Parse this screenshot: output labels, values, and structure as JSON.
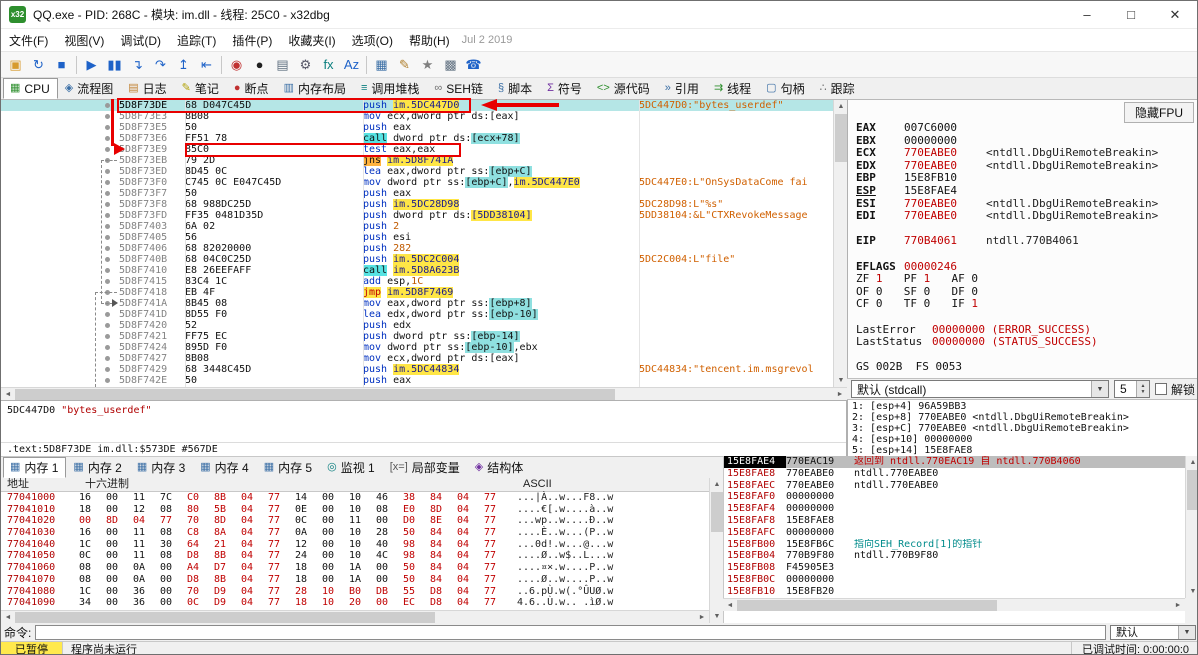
{
  "icons": {
    "minimize": "–",
    "maximize": "□",
    "close": "✕",
    "sb_up": "▲",
    "sb_down": "▼",
    "sb_left": "◄",
    "sb_right": "►",
    "combo_arrow": "▼",
    "spin_up": "▲",
    "spin_down": "▼",
    "app_badge": "x32"
  },
  "window": {
    "title": "QQ.exe - PID: 268C - 模块: im.dll - 线程: 25C0 - x32dbg"
  },
  "menu": {
    "items": [
      "文件(F)",
      "视图(V)",
      "调试(D)",
      "追踪(T)",
      "插件(P)",
      "收藏夹(I)",
      "选项(O)",
      "帮助(H)"
    ],
    "date": "Jul 2 2019"
  },
  "toolbar": {
    "items": [
      {
        "name": "open-file",
        "glyph": "▣",
        "color": "#d79b2e"
      },
      {
        "name": "restart",
        "glyph": "↻",
        "color": "#1e62c8"
      },
      {
        "name": "stop-debug",
        "glyph": "■",
        "color": "#1e62c8"
      },
      {
        "sep": true
      },
      {
        "name": "run",
        "glyph": "▶",
        "color": "#1e62c8"
      },
      {
        "name": "pause",
        "glyph": "▮▮",
        "color": "#1e62c8"
      },
      {
        "name": "step-into",
        "glyph": "↴",
        "color": "#1e62c8"
      },
      {
        "name": "step-over",
        "glyph": "↷",
        "color": "#1e62c8"
      },
      {
        "name": "step-out",
        "glyph": "↥",
        "color": "#1e62c8"
      },
      {
        "name": "execute-till-return",
        "glyph": "⇤",
        "color": "#1e62c8"
      },
      {
        "sep": true
      },
      {
        "name": "trace-record",
        "glyph": "◉",
        "color": "#c03030"
      },
      {
        "name": "breakpoints",
        "glyph": "●",
        "color": "#202020"
      },
      {
        "name": "memory-page",
        "glyph": "▤",
        "color": "#607080"
      },
      {
        "name": "settings-gear",
        "glyph": "⚙",
        "color": "#555566"
      },
      {
        "name": "script-fx",
        "glyph": "fx",
        "color": "#0b7f7f"
      },
      {
        "name": "font-size",
        "glyph": "Az",
        "color": "#1e62c8"
      },
      {
        "sep": true
      },
      {
        "name": "patches",
        "glyph": "▦",
        "color": "#3a6ea5"
      },
      {
        "name": "comment",
        "glyph": "✎",
        "color": "#b08030"
      },
      {
        "name": "favourites",
        "glyph": "★",
        "color": "#808080"
      },
      {
        "name": "calculator",
        "glyph": "▩",
        "color": "#607080"
      },
      {
        "name": "attach",
        "glyph": "☎",
        "color": "#1e62c8"
      }
    ]
  },
  "tabs": [
    {
      "id": "cpu",
      "label": "CPU",
      "glyph": "▦",
      "color": "#2e8f2e",
      "active": true
    },
    {
      "id": "graph",
      "label": "流程图",
      "glyph": "◈",
      "color": "#3a6ea5"
    },
    {
      "id": "log",
      "label": "日志",
      "glyph": "▤",
      "color": "#c08030"
    },
    {
      "id": "notes",
      "label": "笔记",
      "glyph": "✎",
      "color": "#b0a000"
    },
    {
      "id": "breakpoints",
      "label": "断点",
      "glyph": "●",
      "color": "#c03030"
    },
    {
      "id": "memory-map",
      "label": "内存布局",
      "glyph": "▥",
      "color": "#3a6ea5"
    },
    {
      "id": "call-stack",
      "label": "调用堆栈",
      "glyph": "≡",
      "color": "#0b7f7f"
    },
    {
      "id": "seh",
      "label": "SEH链",
      "glyph": "∞",
      "color": "#707070"
    },
    {
      "id": "script",
      "label": "脚本",
      "glyph": "§",
      "color": "#3a6ea5"
    },
    {
      "id": "symbols",
      "label": "符号",
      "glyph": "Σ",
      "color": "#7030a0"
    },
    {
      "id": "source",
      "label": "源代码",
      "glyph": "<>",
      "color": "#2e8f2e"
    },
    {
      "id": "references",
      "label": "引用",
      "glyph": "»",
      "color": "#3a6ea5"
    },
    {
      "id": "threads",
      "label": "线程",
      "glyph": "⇉",
      "color": "#2e8f2e"
    },
    {
      "id": "handles",
      "label": "句柄",
      "glyph": "▢",
      "color": "#3a6ea5"
    },
    {
      "id": "trace",
      "label": "跟踪",
      "glyph": "∴",
      "color": "#707070"
    }
  ],
  "disasm": {
    "rows": [
      {
        "addr": "5D8F73DE",
        "bytes": "68 D047C45D",
        "instr": [
          [
            "push",
            "mn"
          ],
          [
            " ",
            "k"
          ],
          [
            "im.5DC447D0",
            "ay"
          ]
        ],
        "cmt": "5DC447D0:\"bytes_userdef\"",
        "sel": true
      },
      {
        "addr": "5D8F73E3",
        "bytes": "8B08",
        "instr": [
          [
            "mov",
            "mn"
          ],
          [
            " ecx,dword ptr ds:[eax]",
            "k"
          ]
        ]
      },
      {
        "addr": "5D8F73E5",
        "bytes": "50",
        "instr": [
          [
            "push",
            "mn"
          ],
          [
            " eax",
            "k"
          ]
        ]
      },
      {
        "addr": "5D8F73E6",
        "bytes": "FF51 78",
        "instr": [
          [
            "call",
            "callbg"
          ],
          [
            " dword ptr ds:",
            "k"
          ],
          [
            "[ecx+78]",
            "cy"
          ]
        ]
      },
      {
        "addr": "5D8F73E9",
        "bytes": "85C0",
        "instr": [
          [
            "test",
            "mn"
          ],
          [
            " eax,eax",
            "k"
          ]
        ]
      },
      {
        "addr": "5D8F73EB",
        "bytes": "79 2D",
        "instr": [
          [
            "jns",
            "jnsbg"
          ],
          [
            " ",
            "k"
          ],
          [
            "im.5D8F741A",
            "ay"
          ]
        ]
      },
      {
        "addr": "5D8F73ED",
        "bytes": "8D45 0C",
        "instr": [
          [
            "lea",
            "mn"
          ],
          [
            " eax,dword ptr ss:",
            "k"
          ],
          [
            "[ebp+C]",
            "cy"
          ]
        ]
      },
      {
        "addr": "5D8F73F0",
        "bytes": "C745 0C E047C45D",
        "instr": [
          [
            "mov",
            "mn"
          ],
          [
            " dword ptr ss:",
            "k"
          ],
          [
            "[ebp+C]",
            "cy"
          ],
          [
            ",",
            "k"
          ],
          [
            "im.5DC447E0",
            "ay"
          ]
        ],
        "cmt": "5DC447E0:L\"OnSysDataCome fai"
      },
      {
        "addr": "5D8F73F7",
        "bytes": "50",
        "instr": [
          [
            "push",
            "mn"
          ],
          [
            " eax",
            "k"
          ]
        ]
      },
      {
        "addr": "5D8F73F8",
        "bytes": "68 988DC25D",
        "instr": [
          [
            "push",
            "mn"
          ],
          [
            " ",
            "k"
          ],
          [
            "im.5DC28D98",
            "ay"
          ]
        ],
        "cmt": "5DC28D98:L\"%s\""
      },
      {
        "addr": "5D8F73FD",
        "bytes": "FF35 0481D35D",
        "instr": [
          [
            "push",
            "mn"
          ],
          [
            " dword ptr ds:",
            "k"
          ],
          [
            "[5DD38104]",
            "ay"
          ]
        ],
        "cmt": "5DD38104:&L\"CTXRevokeMessage"
      },
      {
        "addr": "5D8F7403",
        "bytes": "6A 02",
        "instr": [
          [
            "push",
            "mn"
          ],
          [
            " ",
            "k"
          ],
          [
            "2",
            "num"
          ]
        ]
      },
      {
        "addr": "5D8F7405",
        "bytes": "56",
        "instr": [
          [
            "push",
            "mn"
          ],
          [
            " esi",
            "k"
          ]
        ]
      },
      {
        "addr": "5D8F7406",
        "bytes": "68 82020000",
        "instr": [
          [
            "push",
            "mn"
          ],
          [
            " ",
            "k"
          ],
          [
            "282",
            "num"
          ]
        ]
      },
      {
        "addr": "5D8F740B",
        "bytes": "68 04C0C25D",
        "instr": [
          [
            "push",
            "mn"
          ],
          [
            " ",
            "k"
          ],
          [
            "im.5DC2C004",
            "ay"
          ]
        ],
        "cmt": "5DC2C004:L\"file\""
      },
      {
        "addr": "5D8F7410",
        "bytes": "E8 26EEFAFF",
        "instr": [
          [
            "call",
            "callbg"
          ],
          [
            " ",
            "k"
          ],
          [
            "im.5D8A623B",
            "ay"
          ]
        ]
      },
      {
        "addr": "5D8F7415",
        "bytes": "83C4 1C",
        "instr": [
          [
            "add",
            "mn"
          ],
          [
            " esp,",
            "k"
          ],
          [
            "1C",
            "num"
          ]
        ]
      },
      {
        "addr": "5D8F7418",
        "bytes": "EB 4F",
        "instr": [
          [
            "jmp",
            "jmpbg"
          ],
          [
            " ",
            "k"
          ],
          [
            "im.5D8F7469",
            "ay"
          ]
        ]
      },
      {
        "addr": "5D8F741A",
        "bytes": "8B45 08",
        "instr": [
          [
            "mov",
            "mn"
          ],
          [
            " eax,dword ptr ss:",
            "k"
          ],
          [
            "[ebp+8]",
            "cy"
          ]
        ]
      },
      {
        "addr": "5D8F741D",
        "bytes": "8D55 F0",
        "instr": [
          [
            "lea",
            "mn"
          ],
          [
            " edx,dword ptr ss:",
            "k"
          ],
          [
            "[ebp-10]",
            "cy"
          ]
        ]
      },
      {
        "addr": "5D8F7420",
        "bytes": "52",
        "instr": [
          [
            "push",
            "mn"
          ],
          [
            " edx",
            "k"
          ]
        ]
      },
      {
        "addr": "5D8F7421",
        "bytes": "FF75 EC",
        "instr": [
          [
            "push",
            "mn"
          ],
          [
            " dword ptr ss:",
            "k"
          ],
          [
            "[ebp-14]",
            "cy"
          ]
        ]
      },
      {
        "addr": "5D8F7424",
        "bytes": "895D F0",
        "instr": [
          [
            "mov",
            "mn"
          ],
          [
            " dword ptr ss:",
            "k"
          ],
          [
            "[ebp-10]",
            "cy"
          ],
          [
            ",ebx",
            "k"
          ]
        ]
      },
      {
        "addr": "5D8F7427",
        "bytes": "8B08",
        "instr": [
          [
            "mov",
            "mn"
          ],
          [
            " ecx,dword ptr ds:[eax]",
            "k"
          ]
        ]
      },
      {
        "addr": "5D8F7429",
        "bytes": "68 3448C45D",
        "instr": [
          [
            "push",
            "mn"
          ],
          [
            " ",
            "k"
          ],
          [
            "im.5DC44834",
            "ay"
          ]
        ],
        "cmt": "5DC44834:\"tencent.im.msgrevol"
      },
      {
        "addr": "5D8F742E",
        "bytes": "50",
        "instr": [
          [
            "push",
            "mn"
          ],
          [
            " eax",
            "k"
          ]
        ]
      }
    ]
  },
  "registers": {
    "hide_fpu_label": "隐藏FPU",
    "rows": [
      {
        "type": "reg",
        "name": "EAX",
        "value": "007C6000",
        "red": false,
        "note": ""
      },
      {
        "type": "reg",
        "name": "EBX",
        "value": "00000000",
        "red": false,
        "note": ""
      },
      {
        "type": "reg",
        "name": "ECX",
        "value": "770EABE0",
        "red": true,
        "note": "<ntdll.DbgUiRemoteBreakin>"
      },
      {
        "type": "reg",
        "name": "EDX",
        "value": "770EABE0",
        "red": true,
        "note": "<ntdll.DbgUiRemoteBreakin>"
      },
      {
        "type": "reg",
        "name": "EBP",
        "value": "15E8FB10",
        "red": false,
        "note": ""
      },
      {
        "type": "reg",
        "name": "ESP",
        "value": "15E8FAE4",
        "red": false,
        "note": "",
        "underline": true
      },
      {
        "type": "reg",
        "name": "ESI",
        "value": "770EABE0",
        "red": true,
        "note": "<ntdll.DbgUiRemoteBreakin>"
      },
      {
        "type": "reg",
        "name": "EDI",
        "value": "770EABE0",
        "red": true,
        "note": "<ntdll.DbgUiRemoteBreakin>"
      },
      {
        "type": "sp"
      },
      {
        "type": "reg",
        "name": "EIP",
        "value": "770B4061",
        "red": true,
        "note": "ntdll.770B4061"
      },
      {
        "type": "sp"
      },
      {
        "type": "reg",
        "name": "EFLAGS",
        "value": "00000246",
        "red": true,
        "note": ""
      },
      {
        "type": "flags",
        "pairs": [
          [
            "ZF",
            "1"
          ],
          [
            "PF",
            "1"
          ],
          [
            "AF",
            "0"
          ]
        ]
      },
      {
        "type": "flags",
        "pairs": [
          [
            "OF",
            "0"
          ],
          [
            "SF",
            "0"
          ],
          [
            "DF",
            "0"
          ]
        ]
      },
      {
        "type": "flags",
        "pairs": [
          [
            "CF",
            "0"
          ],
          [
            "TF",
            "0"
          ],
          [
            "IF",
            "1"
          ]
        ]
      },
      {
        "type": "sp"
      },
      {
        "type": "lbl",
        "label": "LastError",
        "rest": "00000000 (ERROR_SUCCESS)"
      },
      {
        "type": "lbl",
        "label": "LastStatus",
        "rest": "00000000 (STATUS_SUCCESS)"
      },
      {
        "type": "sp"
      },
      {
        "type": "plain",
        "text": "GS 002B  FS 0053"
      }
    ]
  },
  "conv": {
    "value": "默认 (stdcall)",
    "count": "5",
    "unlock_label": "解锁"
  },
  "args": [
    "1: [esp+4] 96A59BB3",
    "2: [esp+8] 770EABE0 <ntdll.DbgUiRemoteBreakin>",
    "3: [esp+C] 770EABE0 <ntdll.DbgUiRemoteBreakin>",
    "4: [esp+10] 00000000",
    "5: [esp+14] 15E8FAE8"
  ],
  "info": {
    "addr": "5DC447D0",
    "string": "\"bytes_userdef\"",
    "location": ".text:5D8F73DE im.dll:$573DE #567DE"
  },
  "bottom_tabs": [
    {
      "id": "dump1",
      "label": "内存 1",
      "glyph": "▦",
      "color": "#3a6ea5",
      "active": true
    },
    {
      "id": "dump2",
      "label": "内存 2",
      "glyph": "▦",
      "color": "#3a6ea5"
    },
    {
      "id": "dump3",
      "label": "内存 3",
      "glyph": "▦",
      "color": "#3a6ea5"
    },
    {
      "id": "dump4",
      "label": "内存 4",
      "glyph": "▦",
      "color": "#3a6ea5"
    },
    {
      "id": "dump5",
      "label": "内存 5",
      "glyph": "▦",
      "color": "#3a6ea5"
    },
    {
      "id": "watch1",
      "label": "监视 1",
      "glyph": "◎",
      "color": "#0b7f7f"
    },
    {
      "id": "locals",
      "label": "局部变量",
      "glyph": "[x=]",
      "color": "#555555"
    },
    {
      "id": "struct",
      "label": "结构体",
      "glyph": "◈",
      "color": "#7030a0"
    }
  ],
  "dump": {
    "headers": [
      "地址",
      "十六进制",
      "ASCII"
    ],
    "rows": [
      {
        "addr": "77041000",
        "bytes": "16 00 11 7C C0 8B 04 77 14 00 10 46 38 84 04 77",
        "mask": "kkkkrrrrkkkkrrrr",
        "ascii": "...|À..w...F8..w"
      },
      {
        "addr": "77041010",
        "bytes": "18 00 12 08 80 5B 04 77 0E 00 10 08 E0 8D 04 77",
        "mask": "kkkkrrrrkkkkrrrr",
        "ascii": "....€[.w....à..w"
      },
      {
        "addr": "77041020",
        "bytes": "00 8D 04 77 70 8D 04 77 0C 00 11 00 D0 8E 04 77",
        "mask": "rrrrrrrrkkkkrrrr",
        "ascii": "...wp..w....Ð..w"
      },
      {
        "addr": "77041030",
        "bytes": "16 00 11 08 C8 8A 04 77 0A 00 10 28 50 84 04 77",
        "mask": "kkkkrrrrkkkkrrrr",
        "ascii": "....È..w...(P..w"
      },
      {
        "addr": "77041040",
        "bytes": "1C 00 11 30 64 21 04 77 12 00 10 40 98 84 04 77",
        "mask": "kkkkrrrrkkkkrrrr",
        "ascii": "...0d!.w...@...w"
      },
      {
        "addr": "77041050",
        "bytes": "0C 00 11 08 D8 8B 04 77 24 00 10 4C 98 84 04 77",
        "mask": "kkkkrrrrkkkkrrrr",
        "ascii": "....Ø..w$..L...w"
      },
      {
        "addr": "77041060",
        "bytes": "08 00 0A 00 A4 D7 04 77 18 00 1A 00 50 84 04 77",
        "mask": "kkkkrrrrkkkkrrrr",
        "ascii": "....¤×.w....P..w"
      },
      {
        "addr": "77041070",
        "bytes": "08 00 0A 00 D8 8B 04 77 18 00 1A 00 50 84 04 77",
        "mask": "kkkkrrrrkkkkrrrr",
        "ascii": "....Ø..w....P..w"
      },
      {
        "addr": "77041080",
        "bytes": "1C 00 36 00 70 D9 04 77 28 10 B0 DB 55 D8 04 77",
        "mask": "kkkkrrrrrrrrrrrr",
        "ascii": "..6.pÙ.w(.°ÛUØ.w"
      },
      {
        "addr": "77041090",
        "bytes": "34 00 36 00 0C D9 04 77 18 10 20 00 EC D8 04 77",
        "mask": "kkkkrrrrrrrrrrrr",
        "ascii": "4.6..Ù.w.. .ìØ.w"
      }
    ]
  },
  "stack": {
    "rows": [
      {
        "addr": "15E8FAE4",
        "val": "770EAC19",
        "cmt": "返回到 ntdll.770EAC19 自 ntdll.770B4060",
        "cc": "redc",
        "sel": true
      },
      {
        "addr": "15E8FAE8",
        "val": "770EABE0",
        "vred": true,
        "cmt": "ntdll.770EABE0"
      },
      {
        "addr": "15E8FAEC",
        "val": "770EABE0",
        "vred": true,
        "cmt": "ntdll.770EABE0"
      },
      {
        "addr": "15E8FAF0",
        "val": "00000000",
        "cmt": ""
      },
      {
        "addr": "15E8FAF4",
        "val": "00000000",
        "cmt": ""
      },
      {
        "addr": "15E8FAF8",
        "val": "15E8FAE8",
        "cmt": ""
      },
      {
        "addr": "15E8FAFC",
        "val": "00000000",
        "cmt": ""
      },
      {
        "addr": "15E8FB00",
        "val": "15E8FB6C",
        "cmt": "指向SEH_Record[1]的指针",
        "cc": "teal"
      },
      {
        "addr": "15E8FB04",
        "val": "770B9F80",
        "vred": true,
        "cmt": "ntdll.770B9F80"
      },
      {
        "addr": "15E8FB08",
        "val": "F45905E3",
        "cmt": ""
      },
      {
        "addr": "15E8FB0C",
        "val": "00000000",
        "cmt": ""
      },
      {
        "addr": "15E8FB10",
        "val": "15E8FB20",
        "cmt": ""
      }
    ]
  },
  "command": {
    "label": "命令:",
    "dropdown": "默认"
  },
  "status": {
    "state": "已暂停",
    "message": "程序尚未运行",
    "right": "已调试时间: 0:00:00:0"
  }
}
